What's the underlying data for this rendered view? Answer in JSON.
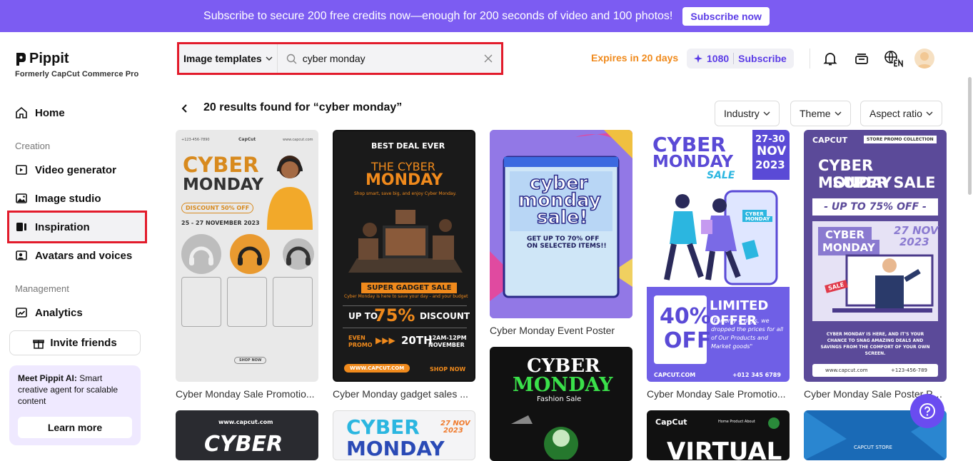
{
  "banner": {
    "text": "Subscribe to secure 200 free credits now—enough for 200 seconds of video and 100 photos!",
    "button": "Subscribe now"
  },
  "brand": {
    "name": "Pippit",
    "subtitle": "Formerly CapCut Commerce Pro"
  },
  "sidebar": {
    "home": "Home",
    "creation_label": "Creation",
    "video_generator": "Video generator",
    "image_studio": "Image studio",
    "inspiration": "Inspiration",
    "avatars": "Avatars and voices",
    "management_label": "Management",
    "analytics": "Analytics",
    "invite": "Invite friends",
    "promo_title": "Meet Pippit AI:",
    "promo_body": " Smart creative agent for scalable content",
    "learn_more": "Learn more"
  },
  "search": {
    "category": "Image templates",
    "query": "cyber monday"
  },
  "header": {
    "expires": "Expires in 20 days",
    "credits": "1080",
    "subscribe": "Subscribe"
  },
  "results": {
    "title": "20 results found for “cyber monday”",
    "filters": [
      "Industry",
      "Theme",
      "Aspect ratio"
    ]
  },
  "cards": [
    {
      "caption": "Cyber Monday Sale Promotio...",
      "title1": "CYBER",
      "title2": "MONDAY",
      "badge": "DISCOUNT 50% OFF",
      "date": "25 - 27 NOVEMBER 2023",
      "top_left": "+123-456-7890",
      "brand": "CapCut",
      "top_right": "www.capcut.com",
      "button": "SHOP NOW"
    },
    {
      "caption": "Cyber Monday gadget sales ...",
      "header": "BEST DEAL EVER",
      "title1": "THE CYBER",
      "title2": "MONDAY",
      "sub": "Shop smart, save big, and enjoy Cyber Monday.",
      "ribbon": "SUPER GADGET SALE",
      "upto": "UP TO",
      "pct": "75%",
      "discount": "DISCOUNT",
      "even": "EVEN",
      "promo": "PROMO",
      "day": "20TH",
      "time": "12AM-12PM",
      "month": "NOVEMBER",
      "url": "WWW.CAPCUT.COM",
      "shop": "SHOP NOW"
    },
    {
      "caption": "Cyber Monday Event Poster",
      "t1": "cyber",
      "t2": "monday",
      "t3": "sale!",
      "offer1": "GET UP TO 70% OFF",
      "offer2": "ON SELECTED ITEMS!!"
    },
    {
      "caption": "Cyber Monday Sale Promotio...",
      "t1": "CYBER",
      "t2": "MONDAY",
      "t3": "SALE",
      "date": "27-30",
      "month": "NOV",
      "year": "2023",
      "pct": "40%",
      "off": "OFF",
      "limited": "LIMITED OFFER",
      "desc": "\"For only 4 days, we dropped the prices for all of Our Products and Market goods\"",
      "url": "CAPCUT.COM",
      "phone": "+012 345 6789",
      "tag1": "CYBER",
      "tag2": "MONDAY"
    },
    {
      "caption": "Cyber Monday Sale Poster Pr...",
      "brand": "CAPCUT",
      "nav": "STORE  PROMO  COLLECTION",
      "t1": "CYBER MONDAY",
      "t2": "SUPER SALE",
      "upto": "- UP TO 75% OFF -",
      "c1": "CYBER",
      "c2": "MONDAY",
      "date1": "27 NOV",
      "date2": "2023",
      "sale": "SALE",
      "url": "www.capcut.com",
      "phone": "+123-456-789"
    },
    {
      "caption": "",
      "url": "www.capcut.com",
      "t1": "CYBER"
    },
    {
      "caption": "",
      "t1": "CYBER",
      "t2": "MONDAY",
      "date1": "27 NOV",
      "date2": "2023"
    },
    {
      "caption": "",
      "t1": "CYBER",
      "t2": "MONDAY",
      "sub": "Fashion Sale"
    },
    {
      "caption": "",
      "brand": "CapCut",
      "nav": "Home  Product  About",
      "t1": "VIRTUAL"
    },
    {
      "caption": "",
      "t1": "CAPCUT STORE"
    }
  ]
}
